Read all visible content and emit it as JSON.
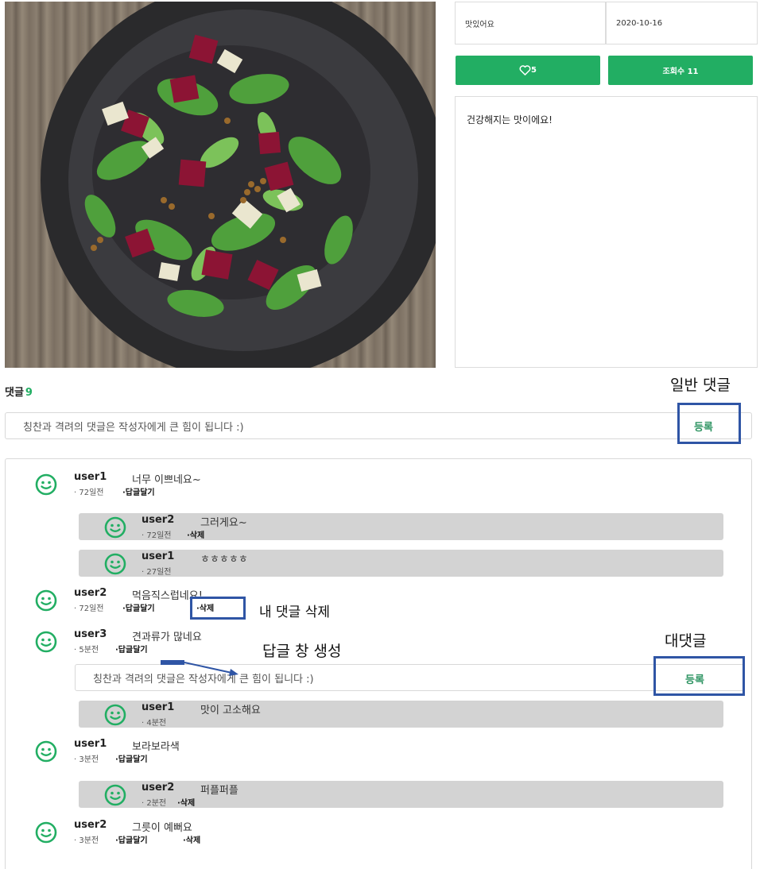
{
  "post": {
    "image_alt": "beet and pear salad on a dark plate",
    "taste": "맛있어요",
    "date": "2020-10-16",
    "likes": "5",
    "views_label": "조회수 11",
    "content": "건강해지는 맛이에요!"
  },
  "comments_section": {
    "title": "댓글",
    "count": "9",
    "input_placeholder": "칭찬과 격려의 댓글은 작성자에게 큰 힘이 됩니다 :)",
    "submit_label": "등록"
  },
  "comments": [
    {
      "author": "user1",
      "text": "너무 이쁘네요~",
      "time": "· 72일전",
      "action1": "·답글달기",
      "action2": ""
    },
    {
      "author": "user2",
      "text": "먹음직스럽네요!",
      "time": "· 72일전",
      "action1": "·답글달기",
      "action2": "·삭제"
    },
    {
      "author": "user3",
      "text": "견과류가 많네요",
      "time": "· 5분전",
      "action1": "·답글달기",
      "action2": ""
    },
    {
      "author": "user1",
      "text": "보라보라색",
      "time": "· 3분전",
      "action1": "·답글달기",
      "action2": ""
    },
    {
      "author": "user2",
      "text": "그릇이 예뻐요",
      "time": "· 3분전",
      "action1": "·답글달기",
      "action2": "·삭제"
    }
  ],
  "replies": [
    {
      "author": "user2",
      "text": "그러게요~",
      "time": "· 72일전",
      "action": "·삭제"
    },
    {
      "author": "user1",
      "text": "ㅎㅎㅎㅎㅎ",
      "time": "· 27일전",
      "action": ""
    },
    {
      "author": "user1",
      "text": "맛이 고소해요",
      "time": "· 4분전",
      "action": ""
    },
    {
      "author": "user2",
      "text": "퍼플퍼플",
      "time": "· 2분전",
      "action": "·삭제"
    }
  ],
  "reply_form": {
    "placeholder": "칭찬과 격려의 댓글은 작성자에게 큰 힘이 됩니다 :)",
    "submit_label": "등록"
  },
  "annotations": {
    "general_comment": "일반 댓글",
    "delete_my_comment": "내 댓글 삭제",
    "reply_window": "답글 창 생성",
    "nested_comment": "대댓글"
  },
  "colors": {
    "accent_green": "#22ae63",
    "annotation_blue": "#2f55a5",
    "reply_bg": "#d3d3d3"
  },
  "icons": {
    "heart": "heart-outline-icon",
    "avatar": "smiley-icon"
  }
}
